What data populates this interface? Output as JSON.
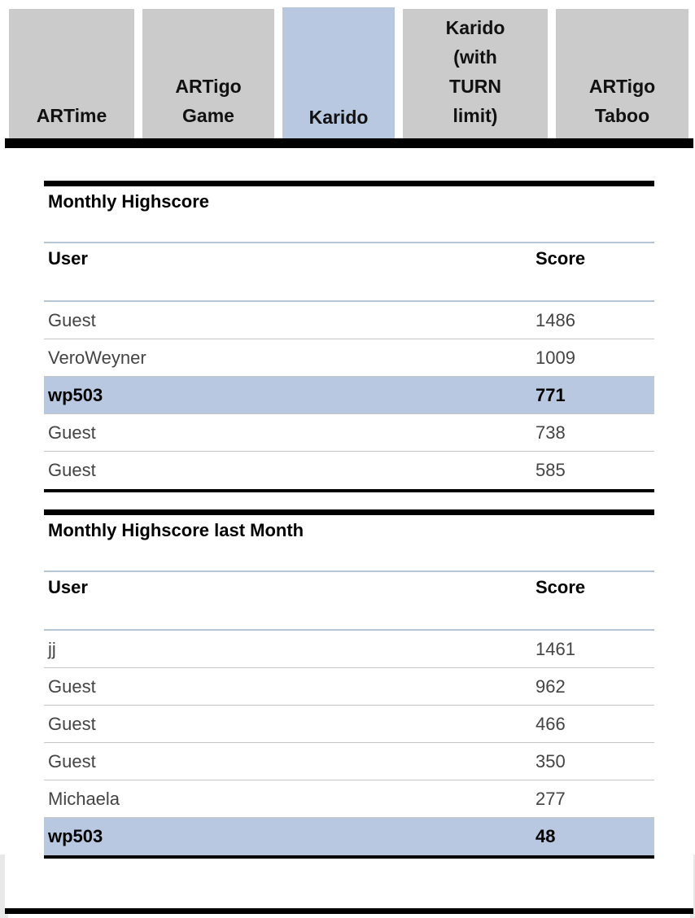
{
  "tabs": [
    {
      "label": "ARTime",
      "active": false
    },
    {
      "label": "ARTigo\nGame",
      "active": false
    },
    {
      "label": "Karido",
      "active": true
    },
    {
      "label": "Karido\n(with\nTURN\nlimit)",
      "active": false
    },
    {
      "label": "ARTigo\nTaboo",
      "active": false
    }
  ],
  "colors": {
    "tab_bg": "#cbcbcb",
    "tab_active_bg": "#b8c8e1",
    "highlight_row": "#b8c8e1"
  },
  "monthly": {
    "title": "Monthly Highscore",
    "col_user": "User",
    "col_score": "Score",
    "rows": [
      {
        "user": "Guest",
        "score": "1486"
      },
      {
        "user": "VeroWeyner",
        "score": "1009"
      },
      {
        "user": "wp503",
        "score": "771"
      },
      {
        "user": "Guest",
        "score": "738"
      },
      {
        "user": "Guest",
        "score": "585"
      }
    ]
  },
  "last_month": {
    "title": "Monthly Highscore last Month",
    "col_user": "User",
    "col_score": "Score",
    "rows": [
      {
        "user": "jj",
        "score": "1461"
      },
      {
        "user": "Guest",
        "score": "962"
      },
      {
        "user": "Guest",
        "score": "466"
      },
      {
        "user": "Guest",
        "score": "350"
      },
      {
        "user": "Michaela",
        "score": "277"
      },
      {
        "user": "wp503",
        "score": "48"
      }
    ]
  },
  "current_user": "wp503"
}
